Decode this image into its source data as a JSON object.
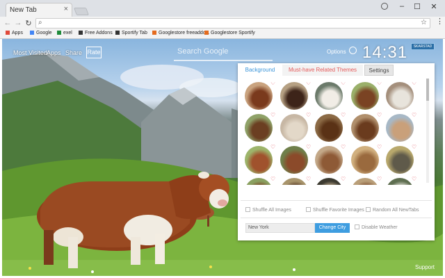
{
  "browser": {
    "tab_title": "New Tab",
    "tab_close": "×",
    "window_controls": [
      "–",
      "☐",
      "✕"
    ],
    "bookmarks": [
      {
        "label": "Apps",
        "icon": "apps-grid-icon",
        "color": "#e04a3a"
      },
      {
        "label": "Google",
        "icon": "google-g-icon",
        "color": "#4285f4"
      },
      {
        "label": "exel",
        "icon": "sheet-icon",
        "color": "#1e8a3a"
      },
      {
        "label": "Free Addons",
        "icon": "addon-icon",
        "color": "#333333"
      },
      {
        "label": "Sportify Tab",
        "icon": "tab-icon",
        "color": "#333333"
      },
      {
        "label": "Googlestore freeaddo...",
        "icon": "store-icon",
        "color": "#e46b1e"
      },
      {
        "label": "Googlestore Sportify",
        "icon": "store-icon",
        "color": "#e46b1e"
      }
    ]
  },
  "newtab": {
    "links": [
      "Most Visited",
      "Apps",
      "Share"
    ],
    "rate_label": "Rate",
    "search_placeholder": "Search Google",
    "options_label": "Options",
    "clock": "14:31",
    "weather_badge": "SKARSTAD",
    "support_label": "Support"
  },
  "options_panel": {
    "tabs": [
      "Background",
      "Must-have Related Themes",
      "Settings"
    ],
    "active_tab": "Background",
    "thumbnails": [
      {
        "bg": "#c9a37f",
        "fg": "#7a3a1d"
      },
      {
        "bg": "#b5a083",
        "fg": "#3d2419"
      },
      {
        "bg": "#6b7a6a",
        "fg": "#f1ede6"
      },
      {
        "bg": "#9ab06a",
        "fg": "#7a4323"
      },
      {
        "bg": "#a48f7c",
        "fg": "#e8e4dc"
      },
      {
        "bg": "#8fa268",
        "fg": "#6b3f22"
      },
      {
        "bg": "#c7b7a4",
        "fg": "#e3d8c8"
      },
      {
        "bg": "#8b6a45",
        "fg": "#5a3216"
      },
      {
        "bg": "#b08f6c",
        "fg": "#6a3b1e"
      },
      {
        "bg": "#a7b8c6",
        "fg": "#c9a07a"
      },
      {
        "bg": "#9db56b",
        "fg": "#a0522d"
      },
      {
        "bg": "#6f7f4a",
        "fg": "#8b4a2a"
      },
      {
        "bg": "#c3a888",
        "fg": "#8e5a36"
      },
      {
        "bg": "#d1b07f",
        "fg": "#9a6a3e"
      },
      {
        "bg": "#b8a86c",
        "fg": "#5f5a4a"
      },
      {
        "bg": "#8aa060",
        "fg": "#7a3d20"
      },
      {
        "bg": "#a8946b",
        "fg": "#523422"
      },
      {
        "bg": "#3c3a30",
        "fg": "#c6b08f"
      },
      {
        "bg": "#b99e78",
        "fg": "#7b4a2a"
      },
      {
        "bg": "#5e6e50",
        "fg": "#f0ece4"
      }
    ],
    "heart": "♡",
    "checkboxes": [
      "Shuffle All Images",
      "Shuffle Favorite Images",
      "Random All NewTabs"
    ],
    "city_value": "New York",
    "change_city_label": "Change City",
    "disable_weather_label": "Disable Weather"
  }
}
